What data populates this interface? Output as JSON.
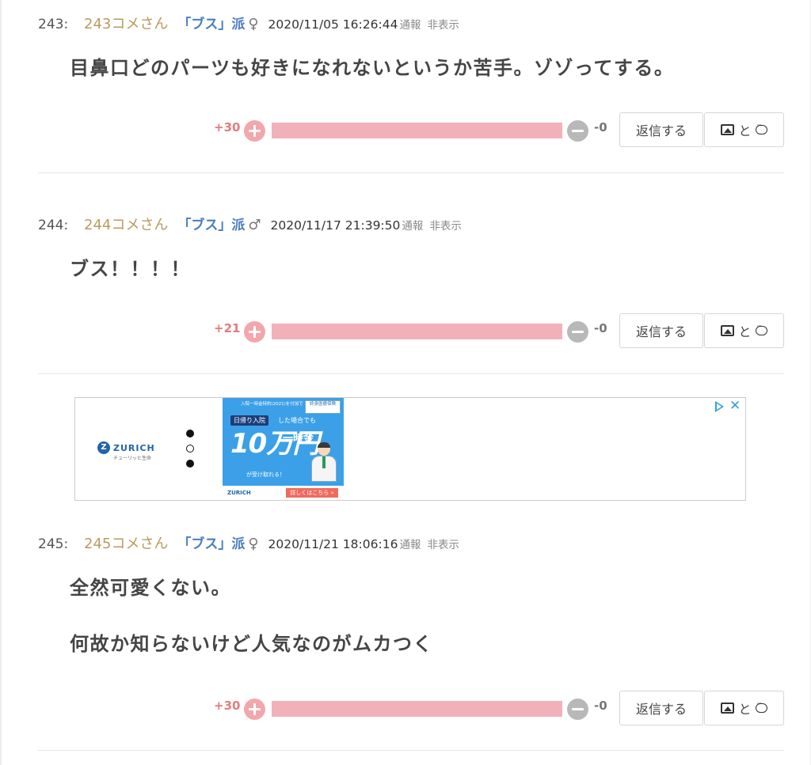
{
  "comments": [
    {
      "num": "243:",
      "author": "243コメさん",
      "ha": "「ブス」派",
      "sex": "♀",
      "date": "2020/11/05 16:26:44",
      "report": "通報",
      "hide": "非表示",
      "lines": [
        "目鼻口どのパーツも好きになれないというか苦手。ゾゾってする。"
      ],
      "plus": "+30",
      "minus": "-0",
      "plus_ratio": 1.0,
      "reply_label": "返信する",
      "media_label": "と"
    },
    {
      "num": "244:",
      "author": "244コメさん",
      "ha": "「ブス」派",
      "sex": "♂",
      "date": "2020/11/17 21:39:50",
      "report": "通報",
      "hide": "非表示",
      "lines": [
        "ブス！！！！"
      ],
      "plus": "+21",
      "minus": "-0",
      "plus_ratio": 1.0,
      "reply_label": "返信する",
      "media_label": "と"
    },
    {
      "num": "245:",
      "author": "245コメさん",
      "ha": "「ブス」派",
      "sex": "♀",
      "date": "2020/11/21 18:06:16",
      "report": "通報",
      "hide": "非表示",
      "lines": [
        "全然可愛くない。",
        "何故か知らないけど人気なのがムカつく"
      ],
      "plus": "+30",
      "minus": "-0",
      "plus_ratio": 1.0,
      "reply_label": "返信する",
      "media_label": "と"
    }
  ],
  "ad": {
    "logo": "ZURICH",
    "logo_sub": "チューリッヒ生命",
    "banner_top": "入院一時金特約(2021)を付加で",
    "banner_tag": "終身医療保険",
    "banner_pill": "日帰り入院",
    "banner_pill2": "した場合でも",
    "banner_big": "10万円",
    "banner_ichi": "一時金",
    "banner_sub": "が受け取れる！",
    "banner_bottom_logo": "ZURICH",
    "banner_cta": "詳しくはこちら »",
    "close": "✕",
    "colors": {
      "banner_bg": "#3ba0e8",
      "cta": "#f06a5e",
      "brand": "#2363a8"
    }
  },
  "colors": {
    "author": "#b99b5f",
    "ha": "#4a7ec0",
    "plus_count": "#e57b7b",
    "plus_bar": "#f2b1b8",
    "minus_button": "#b8b8b8"
  }
}
